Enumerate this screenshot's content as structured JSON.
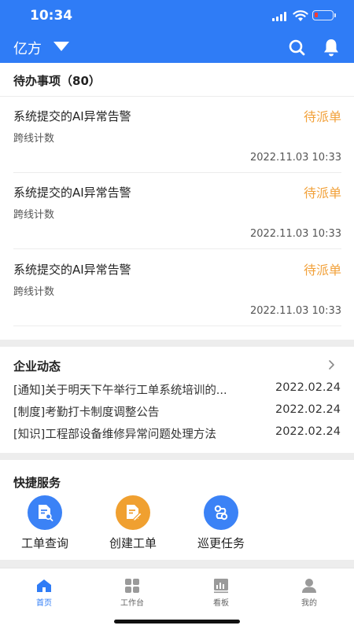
{
  "status_bar": {
    "time": "10:34",
    "battery_level": 0.2
  },
  "navbar": {
    "company": "亿方",
    "icons": [
      "chevron-down-icon",
      "search-icon",
      "bell-icon"
    ]
  },
  "todo": {
    "title": "待办事项（80）",
    "items": [
      {
        "title": "系统提交的AI异常告警",
        "status": "待派单",
        "subtitle": "跨线计数",
        "time": "2022.11.03 10:33"
      },
      {
        "title": "系统提交的AI异常告警",
        "status": "待派单",
        "subtitle": "跨线计数",
        "time": "2022.11.03 10:33"
      },
      {
        "title": "系统提交的AI异常告警",
        "status": "待派单",
        "subtitle": "跨线计数",
        "time": "2022.11.03 10:33"
      }
    ]
  },
  "news": {
    "title": "企业动态",
    "items": [
      {
        "text": "[通知]关于明天下午举行工单系统培训的...",
        "date": "2022.02.24"
      },
      {
        "text": "[制度]考勤打卡制度调整公告",
        "date": "2022.02.24"
      },
      {
        "text": "[知识]工程部设备维修异常问题处理方法",
        "date": "2022.02.24"
      }
    ]
  },
  "quick_services": {
    "title": "快捷服务",
    "items": [
      {
        "label": "工单查询",
        "icon": "document-search-icon",
        "color": "#3b82f6"
      },
      {
        "label": "创建工单",
        "icon": "document-edit-icon",
        "color": "#f0a030"
      },
      {
        "label": "巡更任务",
        "icon": "patrol-route-icon",
        "color": "#3b82f6"
      }
    ]
  },
  "tabbar": {
    "tabs": [
      {
        "label": "首页",
        "icon": "home-icon",
        "active": true
      },
      {
        "label": "工作台",
        "icon": "grid-icon",
        "active": false
      },
      {
        "label": "看板",
        "icon": "dashboard-icon",
        "active": false
      },
      {
        "label": "我的",
        "icon": "user-icon",
        "active": false
      }
    ]
  },
  "colors": {
    "primary": "#2f7cf6",
    "accent_orange": "#f2a13a",
    "text": "#222222",
    "muted": "#555555",
    "background": "#ededed"
  }
}
